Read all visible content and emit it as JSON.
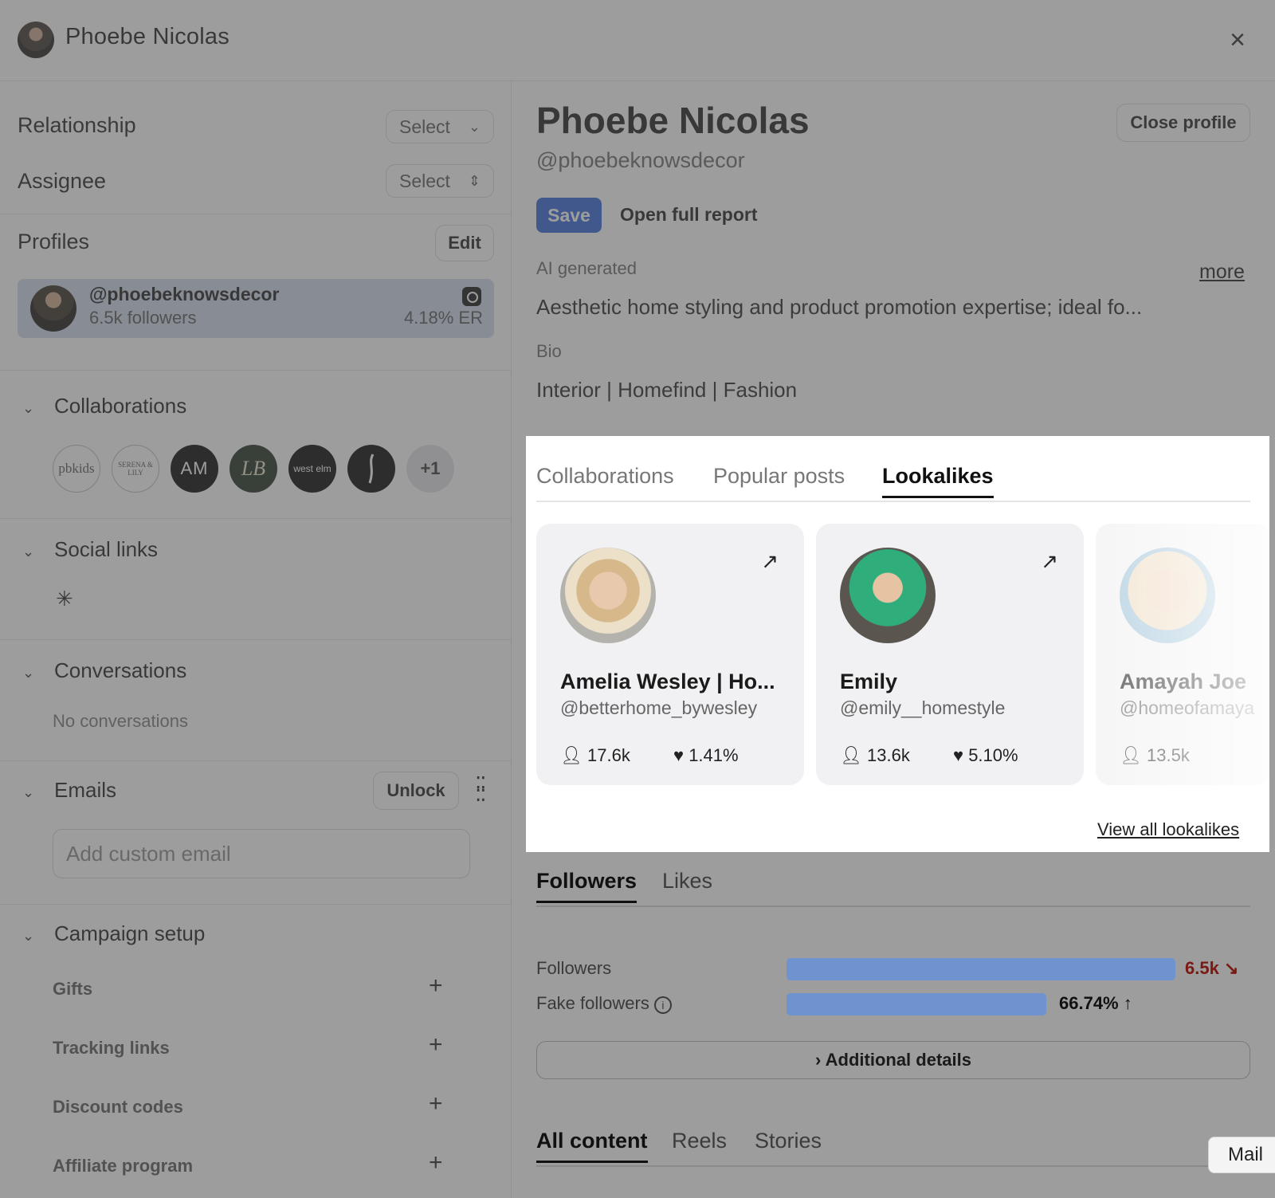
{
  "header": {
    "title": "Phoebe Nicolas",
    "close_glyph": "×"
  },
  "sidebar": {
    "relationship": {
      "label": "Relationship",
      "select": "Select"
    },
    "assignee": {
      "label": "Assignee",
      "select": "Select"
    },
    "profiles": {
      "title": "Profiles",
      "edit": "Edit",
      "card": {
        "handle": "@phoebeknowsdecor",
        "followers": "6.5k followers",
        "er": "4.18% ER"
      }
    },
    "collaborations": {
      "title": "Collaborations",
      "brands": [
        "pbkids",
        "SERENA & LILY",
        "AM",
        "LB",
        "west elm",
        "",
        "+1"
      ]
    },
    "social_links": {
      "title": "Social links",
      "icon_glyph": "✳"
    },
    "conversations": {
      "title": "Conversations",
      "empty": "No conversations"
    },
    "emails": {
      "title": "Emails",
      "unlock": "Unlock",
      "placeholder": "Add custom email"
    },
    "campaign": {
      "title": "Campaign setup",
      "items": [
        "Gifts",
        "Tracking links",
        "Discount codes",
        "Affiliate program"
      ]
    }
  },
  "main": {
    "name": "Phoebe Nicolas",
    "handle": "@phoebeknowsdecor",
    "close_profile": "Close profile",
    "save": "Save",
    "open_report": "Open full report",
    "ai_label": "AI generated",
    "ai_text": "Aesthetic home styling and product promotion expertise; ideal fo...",
    "more": "more",
    "bio_label": "Bio",
    "bio": "Interior | Homefind | Fashion",
    "tabs": [
      "Collaborations",
      "Popular posts",
      "Lookalikes"
    ],
    "lookalikes": [
      {
        "name": "Amelia Wesley | Ho...",
        "handle": "@betterhome_bywesley",
        "followers": "17.6k",
        "er": "1.41%"
      },
      {
        "name": "Emily",
        "handle": "@emily__homestyle",
        "followers": "13.6k",
        "er": "5.10%"
      },
      {
        "name": "Amayah Joe",
        "handle": "@homeofamaya",
        "followers": "13.5k",
        "er": ""
      }
    ],
    "view_all": "View all lookalikes",
    "audience_tabs": [
      "Followers",
      "Likes"
    ],
    "metrics": [
      {
        "label": "Followers",
        "value": "6.5k",
        "trend": "↘",
        "fraction": 1.0,
        "color": "#c0392b"
      },
      {
        "label": "Fake followers",
        "value": "66.74%",
        "trend": "↑",
        "fraction": 0.6674,
        "color": "#1e1e1e"
      }
    ],
    "additional_details": "Additional details",
    "content_tabs": [
      "All content",
      "Reels",
      "Stories"
    ]
  },
  "tooltip": "Mail",
  "colors": {
    "accent": "#2f63d9",
    "bar": "#6f93ce",
    "card_highlight": "#cdd8ec"
  }
}
